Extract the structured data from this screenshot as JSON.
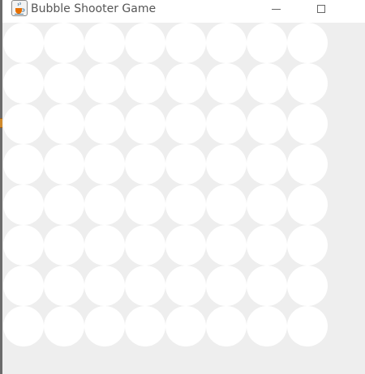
{
  "window": {
    "title": "Bubble Shooter Game",
    "icon": "java-cup-icon",
    "controls": [
      "minimize",
      "maximize"
    ]
  },
  "board": {
    "rows": 8,
    "columns": 8,
    "bubble_color": "#ffffff",
    "background_color": "#eeeeee"
  }
}
